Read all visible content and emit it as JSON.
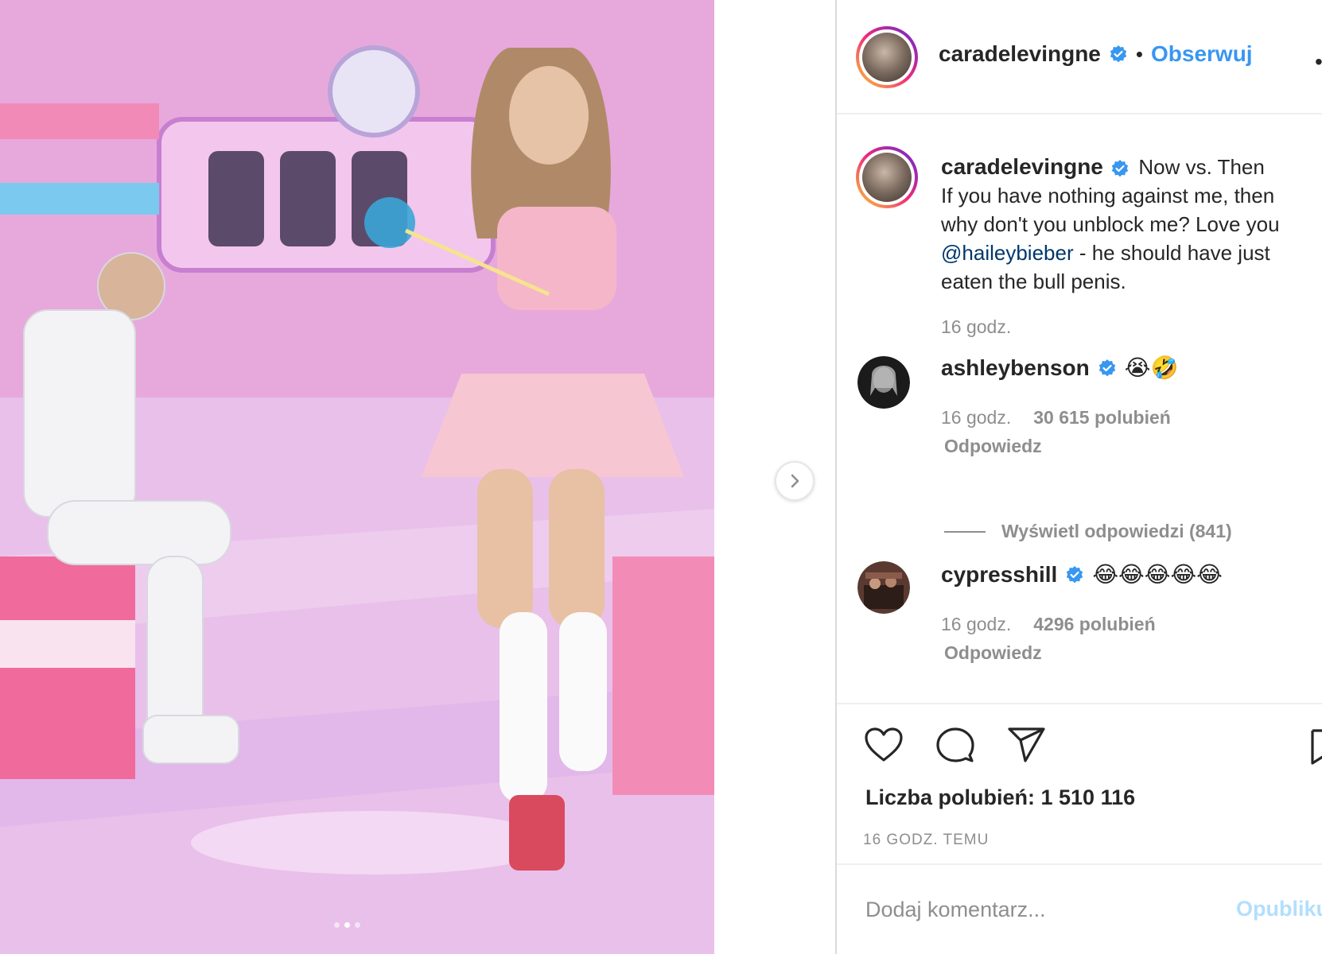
{
  "post": {
    "username": "caradelevingne",
    "follow_label": "Obserwuj",
    "separator": "•",
    "more": "•",
    "media_slides": 3,
    "media_active_slide": 2
  },
  "caption": {
    "username": "caradelevingne",
    "line1": "Now vs. Then",
    "text_part1": "If you have nothing against me, then why don't you unblock me? Love you ",
    "mention": "@haileybieber",
    "text_part2": " - he should have just eaten the bull penis.",
    "time": "16 godz."
  },
  "comments": [
    {
      "username": "ashleybenson",
      "emoji": "😭🤣",
      "time": "16 godz.",
      "likes": "30 615 polubień",
      "reply": "Odpowiedz",
      "view_replies": "Wyświetl odpowiedzi (841)"
    },
    {
      "username": "cypresshill",
      "emoji": "😂😂😂😂😂",
      "time": "16 godz.",
      "likes": "4296 polubień",
      "reply": "Odpowiedz"
    }
  ],
  "actions": {
    "likes_text": "Liczba polubień: 1 510 116",
    "timestamp": "16 GODZ. TEMU"
  },
  "add_comment": {
    "placeholder": "Dodaj komentarz...",
    "publish_label": "Opublikuj"
  },
  "colors": {
    "link_blue": "#3897f0",
    "verified_blue": "#3897f0",
    "muted_text": "#8e8e8e",
    "publish_disabled": "#b2dffc"
  }
}
